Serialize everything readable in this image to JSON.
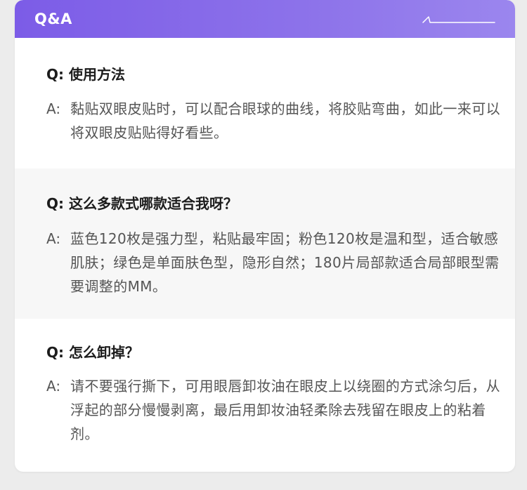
{
  "header": {
    "title": "Q&A"
  },
  "qa_items": [
    {
      "question": "Q: 使用方法",
      "answer_prefix": "A:",
      "answer": "黏贴双眼皮贴时，可以配合眼球的曲线，将胶贴弯曲，如此一来可以将双眼皮贴贴得好看些。"
    },
    {
      "question": "Q: 这么多款式哪款适合我呀？",
      "answer_prefix": "A:",
      "answer": "蓝色120枚是强力型，粘贴最牢固；粉色120枚是温和型，适合敏感肌肤；绿色是单面肤色型，隐形自然；180片局部款适合局部眼型需要调整的MM。"
    },
    {
      "question": "Q: 怎么卸掉？",
      "answer_prefix": "A:",
      "answer": "请不要强行撕下，可用眼唇卸妆油在眼皮上以绕圈的方式涂匀后，从浮起的部分慢慢剥离，最后用卸妆油轻柔除去残留在眼皮上的粘着剂。"
    }
  ],
  "colors": {
    "header_start": "#7c5ce7",
    "header_end": "#9b86ee",
    "question": "#1c1c1c",
    "answer": "#555555",
    "alt_row": "#f7f7f7",
    "page_bg": "#ececec"
  }
}
